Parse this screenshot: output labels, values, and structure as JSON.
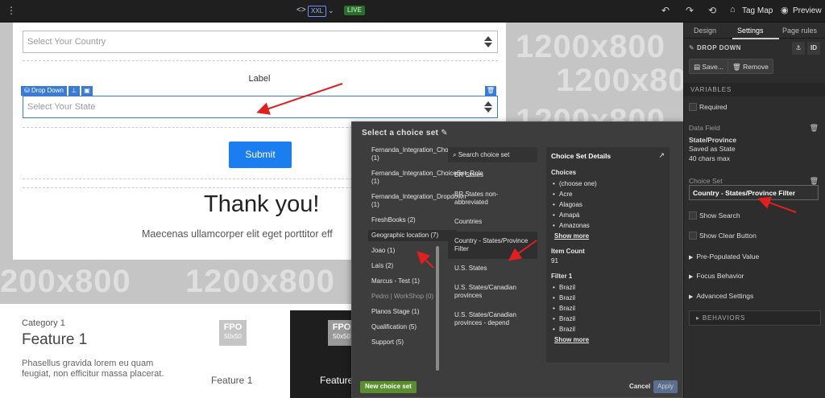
{
  "toolbar": {
    "code_icon": "<>",
    "viewport": "XXL",
    "live": "LIVE",
    "tag_map": "Tag Map",
    "preview": "Preview"
  },
  "canvas": {
    "watermark": "1200x800",
    "watermark_alt": "200x800",
    "country_placeholder": "Select Your Country",
    "label": "Label",
    "dropdown_tag": "Drop Down",
    "state_placeholder": "Select Your State",
    "submit": "Submit",
    "thank_you": "Thank you!",
    "lorem": "Maecenas ullamcorper elit eget porttitor eff",
    "category": "Category 1",
    "feature_big": "Feature 1",
    "paragraph": "Phasellus gravida lorem eu quam feugiat, non efficitur massa placerat.",
    "fpo": "FPO",
    "fpo_size": "50x50",
    "feature_small": "Feature 1",
    "feature_dark": "Feature"
  },
  "modal": {
    "title": "Select a choice set",
    "choice_sets": [
      {
        "label": "Fernanda_Integration_ChoiceSet_Lead (1)",
        "state": "normal"
      },
      {
        "label": "Fernanda_Integration_ChoiceSet_Role (1)",
        "state": "normal"
      },
      {
        "label": "Fernanda_Integration_Dropdown (1)",
        "state": "normal"
      },
      {
        "label": "FreshBooks (2)",
        "state": "normal"
      },
      {
        "label": "Geographic location (7)",
        "state": "active"
      },
      {
        "label": "Joao (1)",
        "state": "normal"
      },
      {
        "label": "Laís (2)",
        "state": "normal"
      },
      {
        "label": "Marcus - Test (1)",
        "state": "normal"
      },
      {
        "label": "Pedro | WorkShop (0)",
        "state": "dim"
      },
      {
        "label": "Planos Stage (1)",
        "state": "normal"
      },
      {
        "label": "Qualification (5)",
        "state": "normal"
      },
      {
        "label": "Support (5)",
        "state": "normal"
      }
    ],
    "search_placeholder": "Search choice set",
    "sets": [
      {
        "label": "BR States",
        "state": "normal"
      },
      {
        "label": "BR States non-abbreviated",
        "state": "normal"
      },
      {
        "label": "Countries",
        "state": "normal"
      },
      {
        "label": "Country - States/Province Filter",
        "state": "active"
      },
      {
        "label": "U.S. States",
        "state": "normal"
      },
      {
        "label": "U.S. States/Canadian provinces",
        "state": "normal"
      },
      {
        "label": "U.S. States/Canadian provinces - depend",
        "state": "normal"
      }
    ],
    "details": {
      "title": "Choice Set Details",
      "choices_label": "Choices",
      "choices": [
        "(choose one)",
        "Acre",
        "Alagoas",
        "Amapá",
        "Amazonas"
      ],
      "show_more": "Show more",
      "item_count_label": "Item Count",
      "item_count": "91",
      "filter_label": "Filter 1",
      "filter_values": [
        "Brazil",
        "Brazil",
        "Brazil",
        "Brazil",
        "Brazil"
      ],
      "show_more_2": "Show more"
    },
    "new_button": "New choice set",
    "cancel_button": "Cancel",
    "apply_button": "Apply"
  },
  "panel": {
    "tabs": [
      "Design",
      "Settings",
      "Page rules"
    ],
    "active_tab": "Settings",
    "header": "DROP DOWN",
    "id_button": "ID",
    "save": "Save...",
    "remove": "Remove",
    "variables_label": "VARIABLES",
    "required": "Required",
    "data_field_label": "Data Field",
    "data_field_name": "State/Province",
    "data_field_saved": "Saved as State",
    "data_field_limit": "40 chars max",
    "choice_set_label": "Choice Set",
    "choice_set_value": "Country - States/Province Filter",
    "show_search": "Show Search",
    "show_clear": "Show Clear Button",
    "pre_populated": "Pre-Populated Value",
    "focus_behavior": "Focus Behavior",
    "advanced": "Advanced Settings",
    "behaviors": "BEHAVIORS"
  },
  "colors": {
    "accent_blue": "#1a7df0",
    "annotation_red": "#e02020",
    "new_button_green": "#5a8f2e"
  }
}
